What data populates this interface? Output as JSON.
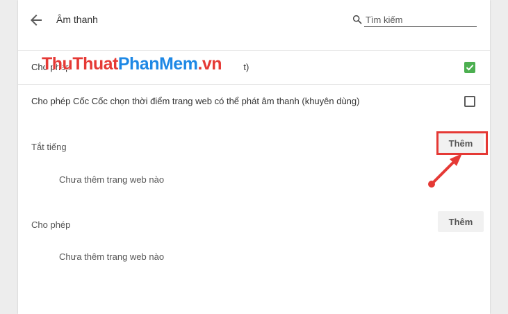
{
  "header": {
    "title": "Âm thanh",
    "back_icon": "arrow-left-icon",
    "search": {
      "placeholder": "Tìm kiếm",
      "value": ""
    }
  },
  "options": [
    {
      "label": "Cho phép trang web phát âm thanh (được đề xuất)",
      "visible_label": "Cho phép",
      "visible_suffix": "t)",
      "checked": true
    },
    {
      "label": "Cho phép Cốc Cốc chọn thời điểm trang web có thể phát âm thanh (khuyên dùng)",
      "checked": false
    }
  ],
  "watermark": {
    "part1": "ThuThuat",
    "part2": "PhanMem",
    "part3": ".vn"
  },
  "mute_section": {
    "title": "Tắt tiếng",
    "add_label": "Thêm",
    "empty_text": "Chưa thêm trang web nào"
  },
  "allow_section": {
    "title": "Cho phép",
    "add_label": "Thêm",
    "empty_text": "Chưa thêm trang web nào"
  },
  "colors": {
    "accent_check": "#4caf50",
    "annotation": "#e53935",
    "watermark_blue": "#1e88e5"
  }
}
